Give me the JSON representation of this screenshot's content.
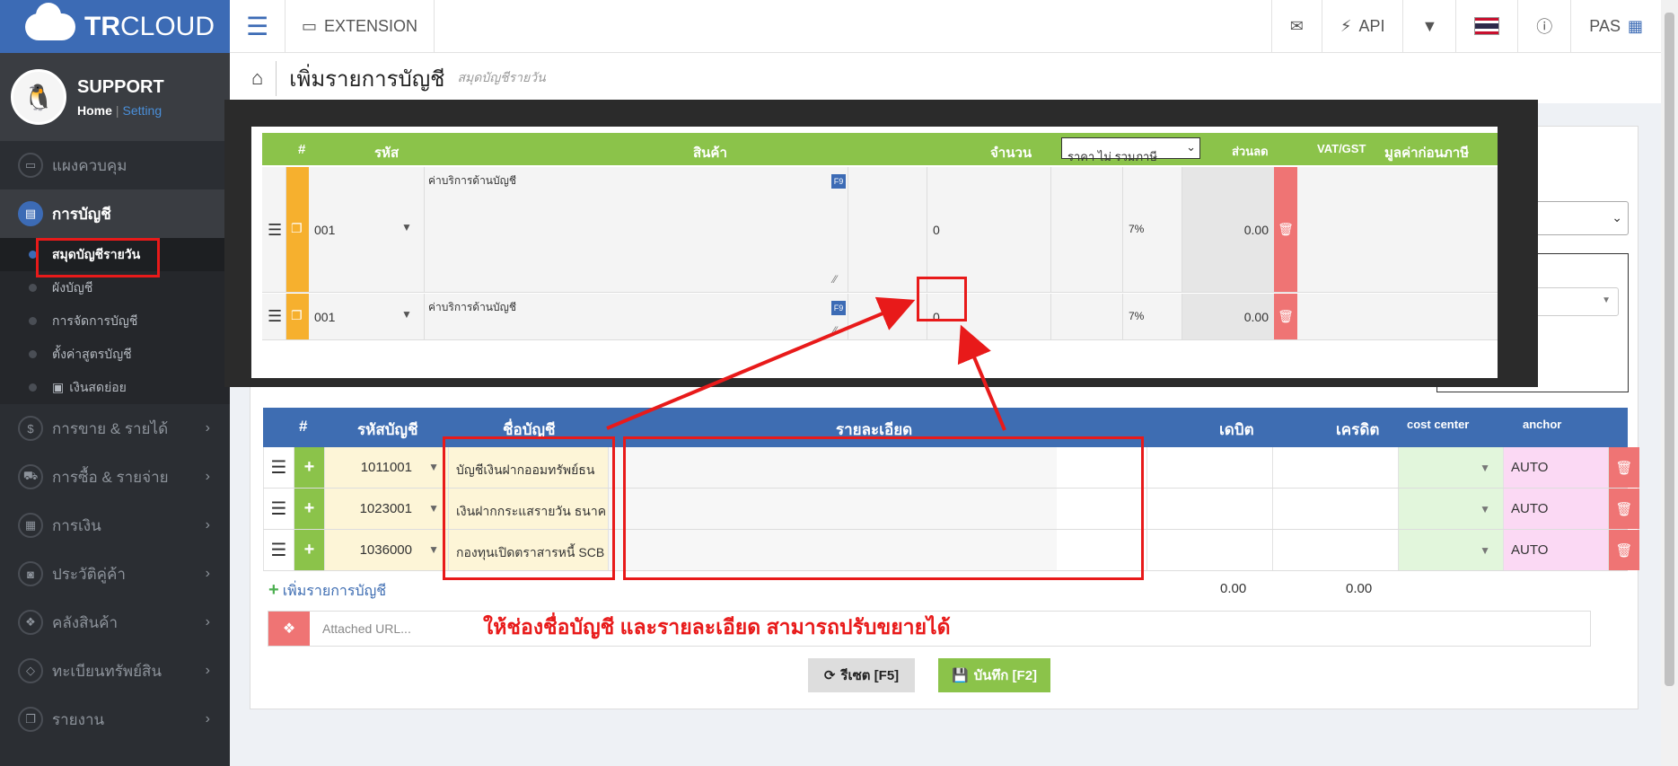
{
  "brand": {
    "bold": "TR",
    "light": "CLOUD"
  },
  "topbar": {
    "extension": "EXTENSION",
    "api": "API",
    "user": "PAS"
  },
  "profile": {
    "name": "SUPPORT",
    "home": "Home",
    "separator": "|",
    "setting": "Setting"
  },
  "sidebar": {
    "dashboard": "แผงควบคุม",
    "accounting": "การบัญชี",
    "sub": [
      "สมุดบัญชีรายวัน",
      "ผังบัญชี",
      "การจัดการบัญชี",
      "ตั้งค่าสูตรบัญชี",
      "เงินสดย่อย"
    ],
    "items": [
      "การขาย & รายได้",
      "การซื้อ & รายจ่าย",
      "การเงิน",
      "ประวัติคู่ค้า",
      "คลังสินค้า",
      "ทะเบียนทรัพย์สิน",
      "รายงาน"
    ]
  },
  "page": {
    "title": "เพิ่มรายการบัญชี",
    "subtitle": "สมุดบัญชีรายวัน"
  },
  "overlay": {
    "headers": {
      "num": "#",
      "code": "รหัส",
      "product": "สินค้า",
      "qty": "จำนวน",
      "price_type": "ราคา ไม่ รวมภาษี",
      "discount": "ส่วนลด",
      "vat": "VAT/GST",
      "pretax": "มูลค่าก่อนภาษี"
    },
    "rows": [
      {
        "code": "001",
        "desc": "ค่าบริการด้านบัญชี",
        "f9": "F9",
        "price": "0",
        "vat": "7%",
        "amount": "0.00"
      },
      {
        "code": "001",
        "desc": "ค่าบริการด้านบัญชี",
        "f9": "F9",
        "price": "0",
        "vat": "7%",
        "amount": "0.00"
      }
    ]
  },
  "journal": {
    "headers": {
      "num": "#",
      "account_code": "รหัสบัญชี",
      "account_name": "ชื่อบัญชี",
      "detail": "รายละเอียด",
      "debit": "เดบิต",
      "credit": "เครดิต",
      "cost_center": "cost center",
      "anchor": "anchor"
    },
    "rows": [
      {
        "code": "1011001",
        "name": "บัญชีเงินฝากออมทรัพย์ธน",
        "anchor": "AUTO"
      },
      {
        "code": "1023001",
        "name": "เงินฝากกระแสรายวัน ธนาค",
        "anchor": "AUTO"
      },
      {
        "code": "1036000",
        "name": "กองทุนเปิดตราสารหนี้ SCB",
        "anchor": "AUTO"
      }
    ],
    "add_label": "เพิ่มรายการบัญชี",
    "total_debit": "0.00",
    "total_credit": "0.00"
  },
  "attach": {
    "placeholder": "Attached URL..."
  },
  "annotation": "ให้ช่องชื่อบัญชี และรายละเอียด สามารถปรับขยายได้",
  "buttons": {
    "reset": "รีเซต [F5]",
    "save": "บันทึก [F2]"
  },
  "colors": {
    "brand": "#3c6bb5",
    "green": "#8bc34a",
    "red": "#ef7474",
    "annotation": "#e81a1a"
  }
}
